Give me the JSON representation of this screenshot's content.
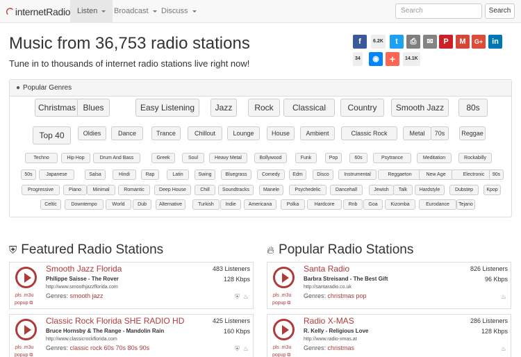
{
  "brand": {
    "name": "internetRadio"
  },
  "nav": {
    "listen": "Listen",
    "broadcast": "Broadcast",
    "discuss": "Discuss"
  },
  "search": {
    "placeholder": "Search",
    "button": "Search"
  },
  "hero": {
    "title": "Music from 36,753 radio stations",
    "subtitle": "Tune in to thousands of internet radio stations live right now!"
  },
  "share": {
    "facebook_count": "6.2K",
    "messenger_count": "34",
    "total_count": "14.1K"
  },
  "genres_panel": {
    "title": "Popular Genres",
    "large": [
      "Christmas",
      "Blues",
      "Easy Listening",
      "Jazz",
      "Rock",
      "Classical",
      "Country",
      "Smooth Jazz",
      "80s",
      "Top 40"
    ],
    "medium": [
      "Oldies",
      "Dance",
      "Trance",
      "Chillout",
      "Lounge",
      "House",
      "Ambient",
      "Classic Rock",
      "Metal",
      "70s",
      "Reggae"
    ],
    "small": [
      "Techno",
      "Hip Hop",
      "Drum And Bass",
      "Greek",
      "Soul",
      "Heavy Metal",
      "Bollywood",
      "Funk",
      "Pop",
      "60s",
      "Psytrance",
      "Meditation",
      "Rockabilly",
      "50s",
      "Japanese",
      "Salsa",
      "Hindi",
      "Rap",
      "Latin",
      "Swing",
      "Bluegrass",
      "Comedy",
      "Edm",
      "Disco",
      "Instrumental",
      "Reggaeton",
      "New Age",
      "Electronic",
      "90s",
      "Progressive",
      "Piano",
      "Minimal",
      "Romantic",
      "Deep House",
      "Chill",
      "Soundtracks",
      "Manele",
      "Psychedelic",
      "Dancehall",
      "Jewish",
      "Talk",
      "Hardstyle",
      "Dubstep",
      "Kpop",
      "Celtic",
      "Downtempo",
      "World",
      "Dub",
      "Alternative",
      "Turkish",
      "Indie",
      "Americana",
      "Polka",
      "Hardcore",
      "Rnb",
      "Goa",
      "Kizomba",
      "Eurodance",
      "Tejano"
    ]
  },
  "featured": {
    "title": "Featured Radio Stations",
    "stations": [
      {
        "name": "Smooth Jazz Florida",
        "song": "Philippe Saisse - The Rover",
        "url": "http://www.smoothjazzflorida.com",
        "genres_label": "Genres:",
        "genres": "smooth jazz",
        "listeners": "483 Listeners",
        "kbps": "128 Kbps",
        "pls": ".pls .m3u",
        "popup": "popup"
      },
      {
        "name": "Classic Rock Florida SHE RADIO HD",
        "song": "Bruce Hornsby & The Range - Mandolin Rain",
        "url": "http://www.classicrockflorida.com",
        "genres_label": "Genres:",
        "genres": "classic rock 60s 70s 80s 90s",
        "listeners": "425 Listeners",
        "kbps": "160 Kbps",
        "pls": ".pls .m3u",
        "popup": "popup"
      }
    ]
  },
  "popular": {
    "title": "Popular Radio Stations",
    "stations": [
      {
        "name": "Santa Radio",
        "song": "Barbra Streisand - The Best Gift",
        "url": "http://santaradio.co.uk",
        "genres_label": "Genres:",
        "genres": "christmas pop",
        "listeners": "826 Listeners",
        "kbps": "96 Kbps",
        "pls": ".pls .m3u",
        "popup": "popup"
      },
      {
        "name": "Radio X-MAS",
        "song": "R. Kelly - Religious Love",
        "url": "http://www.radio-xmas.at",
        "genres_label": "Genres:",
        "genres": "christmas",
        "listeners": "286 Listeners",
        "kbps": "128 Kbps",
        "pls": ".pls .m3u",
        "popup": "popup"
      }
    ]
  }
}
